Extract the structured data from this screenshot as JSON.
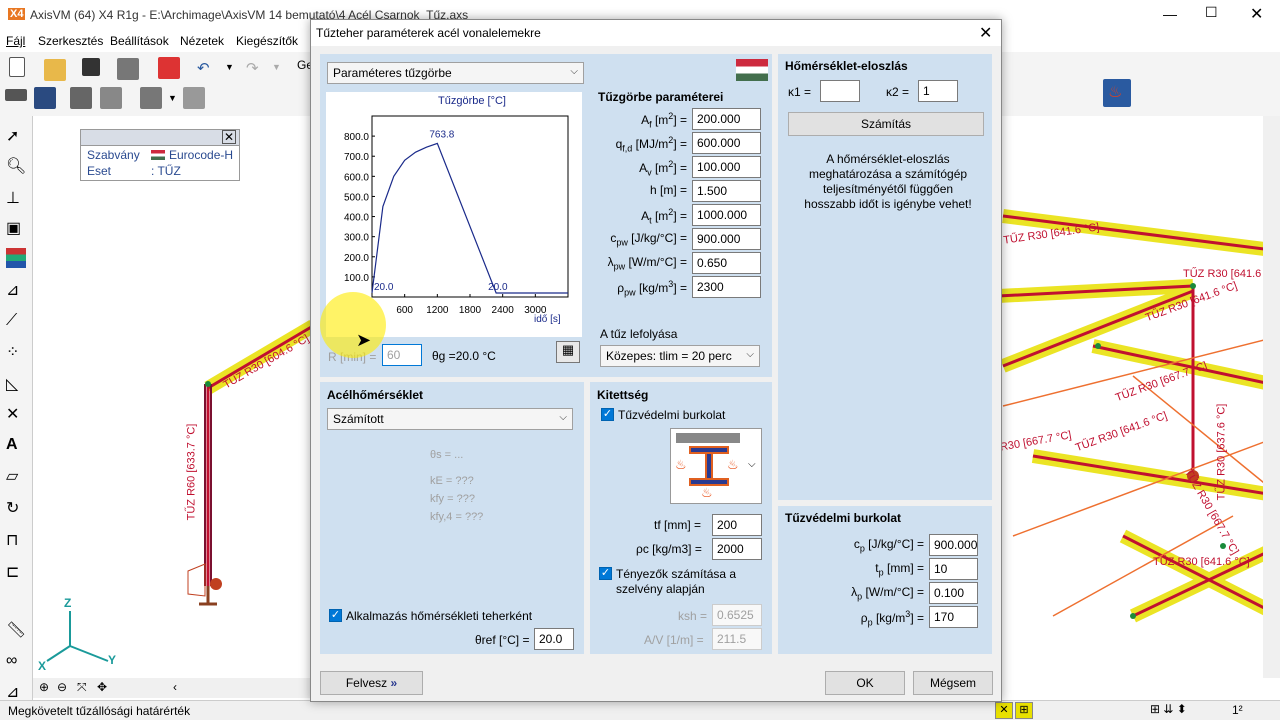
{
  "app": {
    "title": "AxisVM (64) X4 R1g - E:\\Archimage\\AxisVM 14 bemutató\\4 Acél Csarnok_Tűz.axs",
    "logo": "X4"
  },
  "menu": [
    "Fájl",
    "Szerkesztés",
    "Beállítások",
    "Nézetek",
    "Kiegészítők"
  ],
  "toolbar": {
    "tab_partial": "Ge"
  },
  "info_box": {
    "standard_label": "Szabvány",
    "standard_value": "Eurocode-H",
    "case_label": "Eset",
    "case_value": ": TŰZ"
  },
  "axes": {
    "z": "Z",
    "x": "X",
    "y": "Y"
  },
  "model_labels": {
    "l1": "TŰZ R30 [641.6 °C]",
    "l2": "TŰZ R30 [667.7 °C]",
    "l3": "TŰZ R30 [641.6 °C]",
    "l4": "TŰZ R30 [641.6 °C]",
    "l5": "ŽR30 [667.7 °C]",
    "l6": "TŰZ R60 [633.7 °C]",
    "l7": "TŰZ R30 [641.6 °C]",
    "l8": "TŰZ R30 [667.7 °C]",
    "l9": "TŰZ R30 [641.6 °C]",
    "l10": "TŰZ R30 [604.6 °C]",
    "l11": "TŰZ R30 [637.6 °C]"
  },
  "status": {
    "text": "Megkövetelt tűzállósági határérték"
  },
  "dialog": {
    "title": "Tűzteher paraméterek acél vonalelemekre",
    "curve_select": "Paraméteres tűzgörbe",
    "chart_title": "Tűzgörbe [°C]",
    "chart_xlabel": "idő [s]",
    "params_title": "Tűzgörbe paraméterei",
    "params": [
      {
        "label_html": "A<sub>f</sub> [m<sup>2</sup>] =",
        "value": "200.000"
      },
      {
        "label_html": "q<sub>f,d</sub> [MJ/m<sup>2</sup>] =",
        "value": "600.000"
      },
      {
        "label_html": "A<sub>v</sub> [m<sup>2</sup>] =",
        "value": "100.000"
      },
      {
        "label_html": "h [m] =",
        "value": "1.500"
      },
      {
        "label_html": "A<sub>t</sub> [m<sup>2</sup>] =",
        "value": "1000.000"
      },
      {
        "label_html": "c<sub>pw</sub> [J/kg/°C] =",
        "value": "900.000"
      },
      {
        "label_html": "λ<sub>pw</sub> [W/m/°C] =",
        "value": "0.650"
      },
      {
        "label_html": "ρ<sub>pw</sub> [kg/m<sup>3</sup>] =",
        "value": "2300"
      }
    ],
    "r_label": "R [min] =",
    "r_value": "60",
    "theta_g": "θg =20.0 °C",
    "fire_course_title": "A tűz lefolyása",
    "fire_course_select": "Közepes: tlim = 20 perc",
    "temp_dist_title": "Hőmérséklet-eloszlás",
    "kappa1_label": "κ1 =",
    "kappa1_value": "",
    "kappa2_label": "κ2 =",
    "kappa2_value": "1",
    "calc_button": "Számítás",
    "note": "A hőmérséklet-eloszlás meghatározása a számítógép teljesítményétől függően hosszabb időt is igénybe vehet!",
    "steel_temp_title": "Acélhőmérséklet",
    "steel_temp_select": "Számított",
    "steel_lines": [
      "θs = ...",
      "kE = ???",
      "kfy = ???",
      "kfy,4 = ???"
    ],
    "apply_thermal": "Alkalmazás hőmérsékleti teherként",
    "theta_ref_label": "θref [°C] =",
    "theta_ref_value": "20.0",
    "exposure_title": "Kitettség",
    "fire_cladding_check": "Tűzvédelmi burkolat",
    "tf_label": "tf [mm] =",
    "tf_value": "200",
    "rhoc_label": "ρc [kg/m3] =",
    "rhoc_value": "2000",
    "factors_check": "Tényezők számítása a szelvény alapján",
    "ksh_label": "ksh =",
    "ksh_value": "0.6525",
    "av_label": "A/V [1/m] =",
    "av_value": "211.5",
    "cladding_title": "Tűzvédelmi burkolat",
    "cladding": [
      {
        "label_html": "c<sub>p</sub> [J/kg/°C] =",
        "value": "900.000"
      },
      {
        "label_html": "t<sub>p</sub> [mm] =",
        "value": "10"
      },
      {
        "label_html": "λ<sub>p</sub> [W/m/°C] =",
        "value": "0.100"
      },
      {
        "label_html": "ρ<sub>p</sub> [kg/m<sup>3</sup>] =",
        "value": "170"
      }
    ],
    "felvesz_button": "Felvesz",
    "ok_button": "OK",
    "cancel_button": "Mégsem"
  },
  "chart_data": {
    "type": "line",
    "title": "Tűzgörbe [°C]",
    "xlabel": "idő [s]",
    "ylabel": "",
    "x": [
      0,
      200,
      400,
      600,
      800,
      1000,
      1200,
      2280,
      3600
    ],
    "series": [
      {
        "values": [
          20.0,
          450,
          600,
          680,
          720,
          745,
          763.8,
          20.0,
          20.0
        ]
      }
    ],
    "xticks": [
      600,
      1200,
      1800,
      2400,
      3000
    ],
    "yticks": [
      100,
      200,
      300,
      400,
      500,
      600,
      700,
      800
    ],
    "ytick_labels": [
      "100.0",
      "200.0",
      "300.0",
      "400.0",
      "500.0",
      "600.0",
      "700.0",
      "800.0"
    ],
    "xlim": [
      0,
      3600
    ],
    "ylim": [
      0,
      900
    ],
    "annotations": [
      {
        "text": "763.8",
        "x": 1200,
        "y": 763.8
      },
      {
        "text": "20.0",
        "x": 0,
        "y": 20
      },
      {
        "text": "20.0",
        "x": 2280,
        "y": 20
      }
    ],
    "grid": false,
    "line_color": "#1a2a8a"
  }
}
